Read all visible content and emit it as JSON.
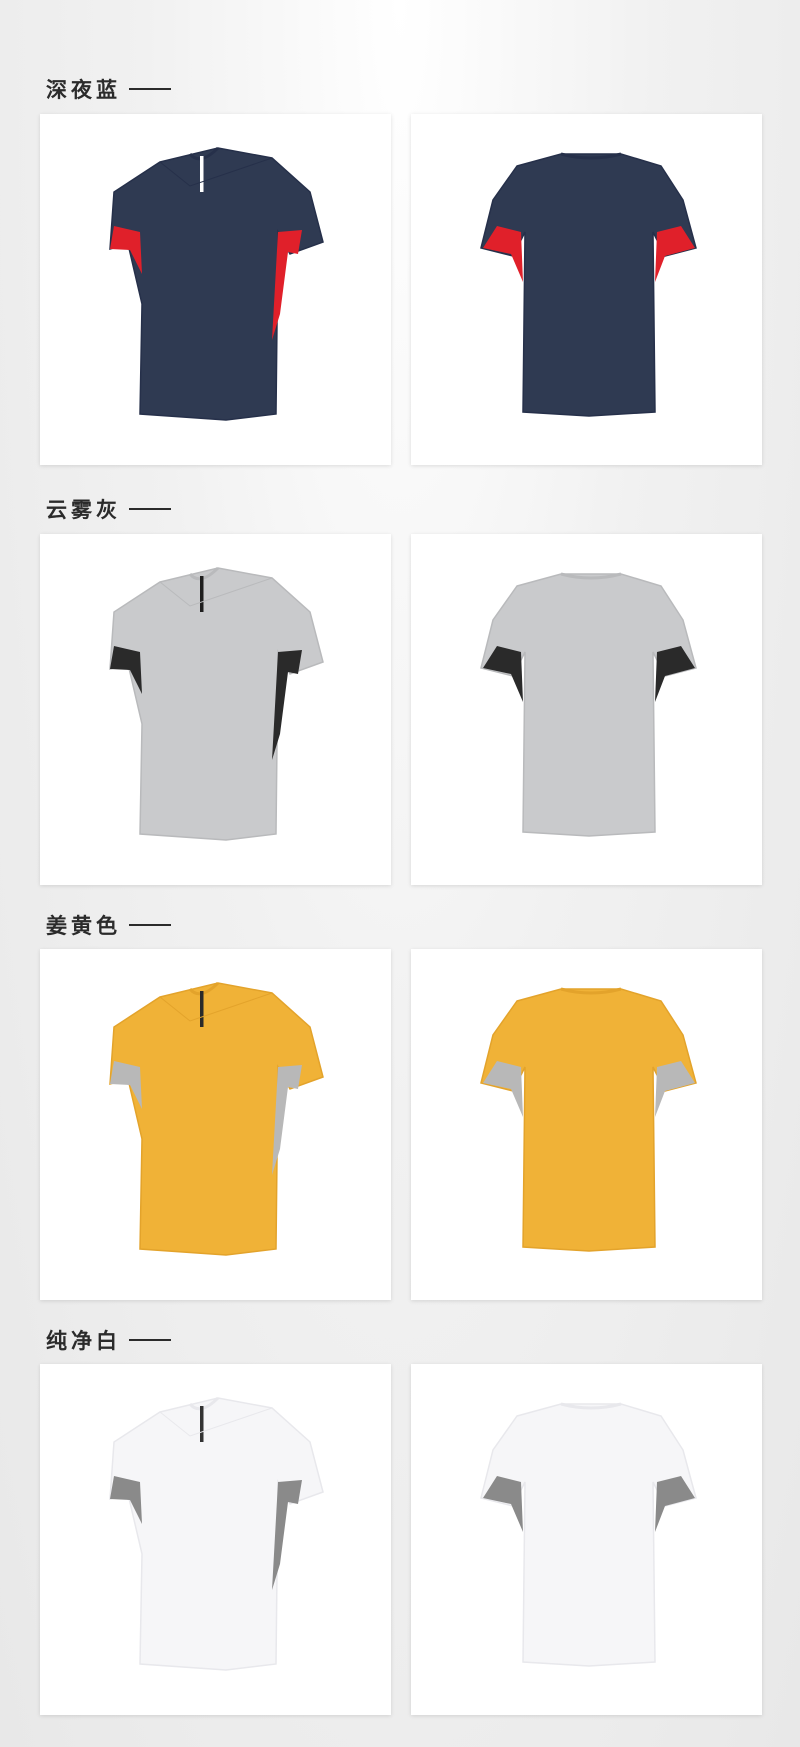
{
  "sections": [
    {
      "title": "深夜蓝",
      "colors": {
        "body": "#2f3a52",
        "dark": "#26304a",
        "panel": "#e0202a",
        "zip": "#ffffff"
      }
    },
    {
      "title": "云雾灰",
      "colors": {
        "body": "#c9cacc",
        "dark": "#b9babc",
        "panel": "#2a2a2a",
        "zip": "#1e1e1e"
      }
    },
    {
      "title": "姜黄色",
      "colors": {
        "body": "#f0b237",
        "dark": "#e3a32b",
        "panel": "#b8b8b8",
        "zip": "#2a2a2a"
      }
    },
    {
      "title": "纯净白",
      "colors": {
        "body": "#f6f6f8",
        "dark": "#e8e8ec",
        "panel": "#8a8a8a",
        "zip": "#333333"
      }
    }
  ],
  "views": [
    "front-view",
    "back-view"
  ]
}
